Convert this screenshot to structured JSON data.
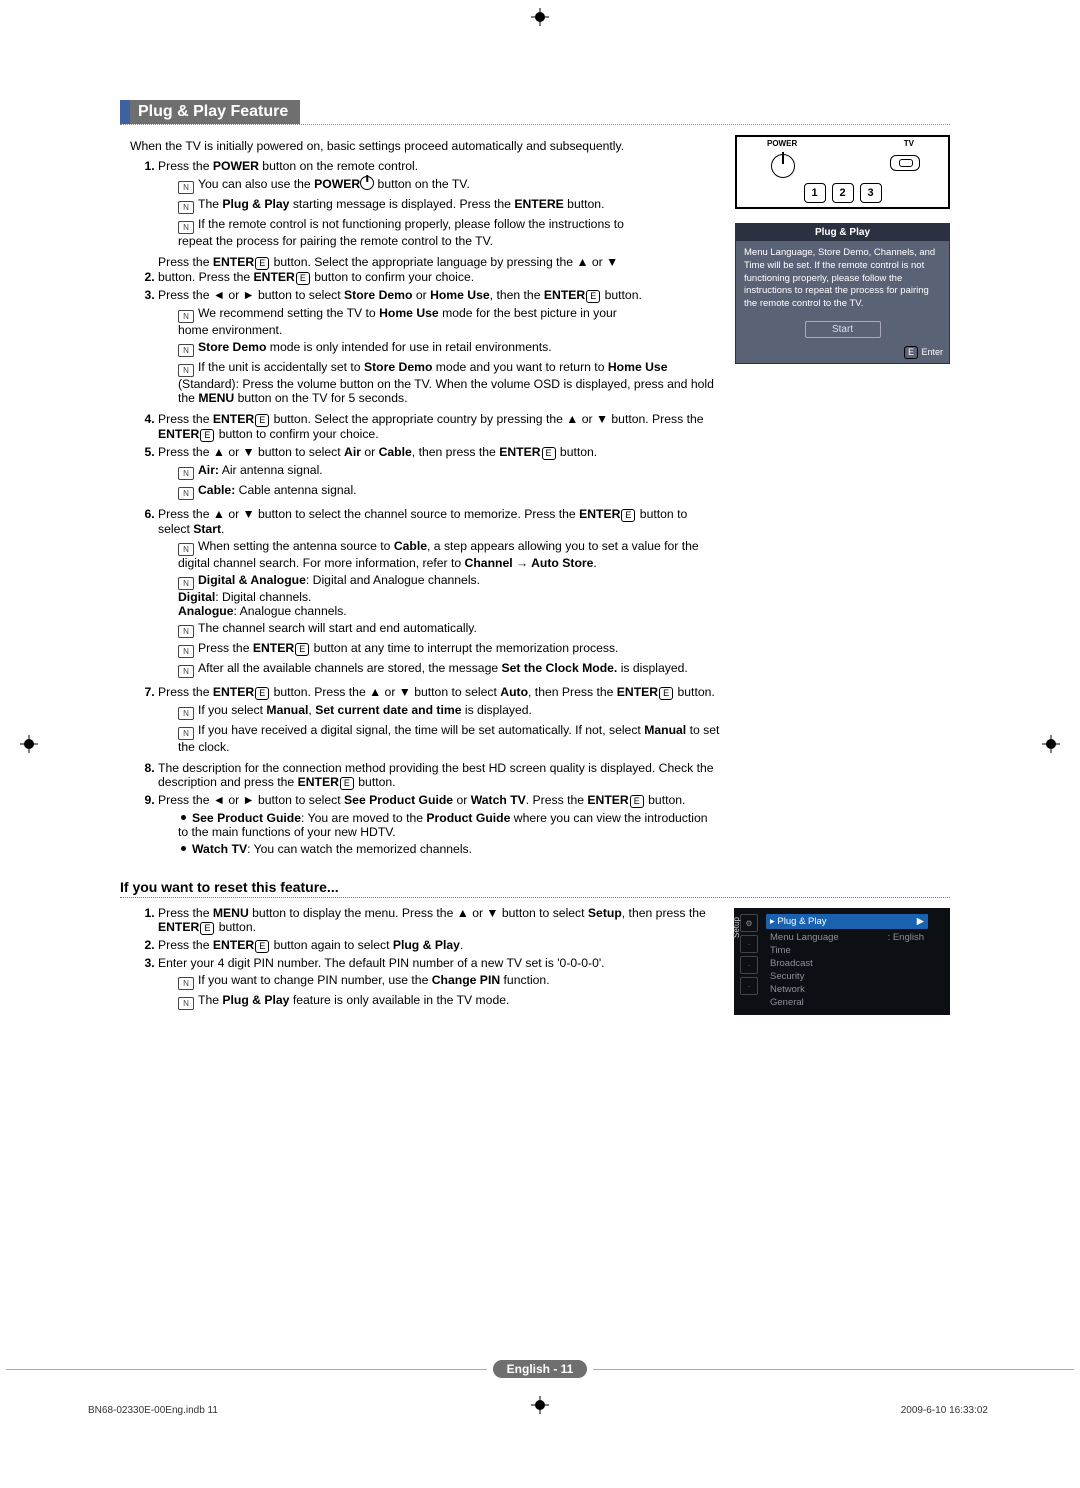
{
  "section": {
    "title": "Plug & Play Feature"
  },
  "intro": "When the TV is initially powered on, basic settings proceed automatically and subsequently.",
  "steps": {
    "s1": {
      "lead": "Press the ",
      "bold1": "POWER",
      "tail": " button on the remote control.",
      "n1a": "You can also use the ",
      "n1b": "POWER",
      "n1c": " button on the TV.",
      "n2a": "The ",
      "n2b": "Plug & Play",
      "n2c": " starting message is displayed. Press the ",
      "n2d": "ENTERE",
      "n2e": " button.",
      "n3": "If the remote control is not functioning properly, please follow the instructions to repeat the process for pairing the remote control to the TV."
    },
    "s2": {
      "a": "Press the ",
      "b": "ENTER",
      "c": " button. Select the appropriate language by pressing the ▲ or ▼ button. Press the ",
      "d": "ENTER",
      "e": " button to confirm your choice."
    },
    "s3": {
      "a": "Press the ◄ or ► button to select ",
      "b": "Store Demo",
      "c": " or ",
      "d": "Home Use",
      "e": ", then the ",
      "f": "ENTER",
      "g": " button.",
      "n1a": "We recommend setting the TV to ",
      "n1b": "Home Use",
      "n1c": " mode for the best picture in your home environment.",
      "n2a": "Store Demo",
      "n2b": " mode is only intended for use in retail environments.",
      "n3a": "If the unit is accidentally set to ",
      "n3b": "Store Demo",
      "n3c": " mode and you want to return to ",
      "n3d": "Home Use",
      "n3e": " (Standard): Press the volume button on the TV. When the volume OSD is displayed, press and hold the ",
      "n3f": "MENU",
      "n3g": " button on the TV for 5 seconds."
    },
    "s4": {
      "a": "Press the ",
      "b": "ENTER",
      "c": " button. Select the appropriate country by pressing the ▲ or ▼ button. Press the ",
      "d": "ENTER",
      "e": " button to confirm your choice."
    },
    "s5": {
      "a": "Press the ▲ or ▼ button to select ",
      "b": "Air",
      "c": " or ",
      "d": "Cable",
      "e": ", then press the ",
      "f": "ENTER",
      "g": " button.",
      "n1a": "Air:",
      "n1b": " Air antenna signal.",
      "n2a": "Cable:",
      "n2b": " Cable antenna signal."
    },
    "s6": {
      "a": "Press the ▲ or ▼ button to select the channel source to memorize. Press the ",
      "b": "ENTER",
      "c": " button to select ",
      "d": "Start",
      "e": ".",
      "n1a": "When setting the antenna source to ",
      "n1b": "Cable",
      "n1c": ", a step appears allowing you to set a value for the digital channel search. For more information, refer to ",
      "n1d": "Channel → Auto Store",
      "n1e": ".",
      "n2a": "Digital & Analogue",
      "n2b": ": Digital and Analogue channels.",
      "n2c": "Digital",
      "n2d": ": Digital channels.",
      "n2e": "Analogue",
      "n2f": ": Analogue channels.",
      "n3": "The channel search will start and end automatically.",
      "n4a": "Press the ",
      "n4b": "ENTER",
      "n4c": " button at any time to interrupt the memorization process.",
      "n5a": "After all the available channels are stored, the message ",
      "n5b": "Set the Clock Mode.",
      "n5c": " is displayed."
    },
    "s7": {
      "a": "Press the ",
      "b": "ENTER",
      "c": " button. Press the ▲ or ▼ button to select ",
      "d": "Auto",
      "e": ", then Press the ",
      "f": "ENTER",
      "g": " button.",
      "n1a": "If you select ",
      "n1b": "Manual",
      "n1c": ", ",
      "n1d": "Set current date and time",
      "n1e": " is displayed.",
      "n2a": "If you have received a digital signal, the time will be set automatically. If not, select ",
      "n2b": "Manual",
      "n2c": " to set the clock."
    },
    "s8": {
      "a": "The description for the connection method providing the best HD screen quality is displayed. Check the description and press the ",
      "b": "ENTER",
      "c": " button."
    },
    "s9": {
      "a": "Press the ◄ or ► button to select ",
      "b": "See Product Guide",
      "c": " or ",
      "d": "Watch TV",
      "e": ". Press the ",
      "f": "ENTER",
      "g": " button.",
      "b1a": "See Product Guide",
      "b1b": ": You are moved to the ",
      "b1c": "Product Guide",
      "b1d": " where you can view the introduction to the main functions of your new HDTV.",
      "b2a": "Watch TV",
      "b2b": ": You can watch the memorized channels."
    }
  },
  "reset": {
    "heading": "If you want to reset this feature...",
    "s1a": "Press the ",
    "s1b": "MENU",
    "s1c": " button to display the menu. Press the ▲ or ▼ button to select ",
    "s1d": "Setup",
    "s1e": ", then press the ",
    "s1f": "ENTER",
    "s1g": " button.",
    "s2a": "Press the ",
    "s2b": "ENTER",
    "s2c": " button again to select ",
    "s2d": "Plug & Play",
    "s2e": ".",
    "s3": "Enter your 4 digit PIN number. The default PIN number of a new TV set is '0-0-0-0'.",
    "n1a": "If you want to change PIN number, use the ",
    "n1b": "Change PIN",
    "n1c": " function.",
    "n2a": "The ",
    "n2b": "Plug & Play",
    "n2c": " feature is only available in the TV mode."
  },
  "remote": {
    "power_label": "POWER",
    "tv_label": "TV",
    "b1": "1",
    "b2": "2",
    "b3": "3"
  },
  "popup": {
    "title": "Plug & Play",
    "msg": "Menu Language, Store Demo, Channels, and Time will be set. If the remote control is not functioning properly, please follow the instructions to repeat the process for pairing the remote control to the TV.",
    "start": "Start",
    "enter": "E Enter"
  },
  "menu": {
    "side": "Setup",
    "row_hl": "Plug & Play",
    "rows": [
      {
        "l": "Menu Language",
        "r": ": English"
      },
      {
        "l": "Time",
        "r": ""
      },
      {
        "l": "Broadcast",
        "r": ""
      },
      {
        "l": "Security",
        "r": ""
      },
      {
        "l": "Network",
        "r": ""
      },
      {
        "l": "General",
        "r": ""
      }
    ]
  },
  "footer": {
    "page": "English - 11",
    "docid": "BN68-02330E-00Eng.indb   11",
    "stamp": "2009-6-10   16:33:02"
  }
}
